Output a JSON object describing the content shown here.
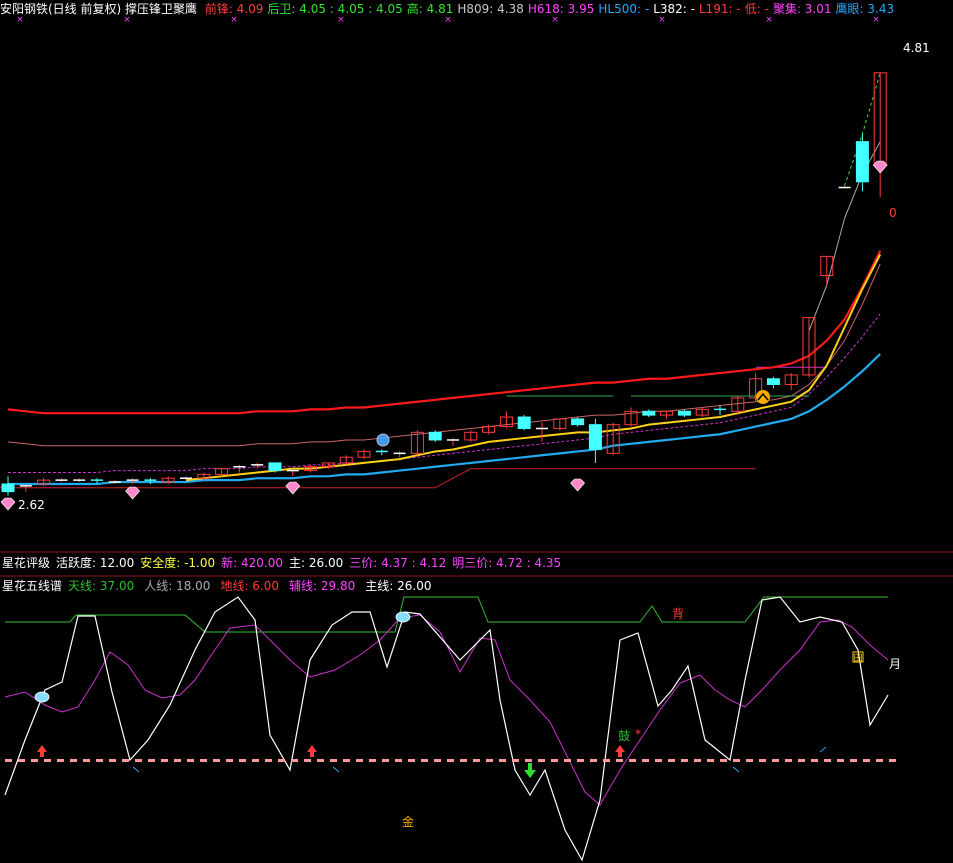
{
  "header": {
    "title": "安阳钢铁(日线 前复权) 撑压锋卫聚鹰",
    "items": [
      {
        "label": "前锋:",
        "value": "4.09",
        "color": "#ff3b3b"
      },
      {
        "label": "后卫:",
        "value": "4.05 : 4.05 : 4.05",
        "color": "#2ee62e"
      },
      {
        "label": "高:",
        "value": "4.81",
        "color": "#2ee62e"
      },
      {
        "label": "H809:",
        "value": "4.38",
        "color": "#c8c8c8"
      },
      {
        "label": "H618:",
        "value": "3.95",
        "color": "#ff44ff"
      },
      {
        "label": "HL500:",
        "value": "-",
        "color": "#22aaff"
      },
      {
        "label": "L382:",
        "value": "-",
        "color": "#ffffff"
      },
      {
        "label": "L191:",
        "value": "-",
        "color": "#ff3b3b"
      },
      {
        "label": "低:",
        "value": "-",
        "color": "#ff3b3b"
      },
      {
        "label": "聚集:",
        "value": "3.01",
        "color": "#ff44ff"
      },
      {
        "label": "鹰眼:",
        "value": "3.43",
        "color": "#22aaff"
      }
    ]
  },
  "colors": {
    "up": "#ff3b3b",
    "down": "#44ffff",
    "ma_red": "#ff1a1a",
    "ma_yellow": "#ffd11a",
    "ma_blue": "#22aaee",
    "purple": "#cc33cc",
    "gray": "#aaaaaa",
    "green": "#33bb33",
    "white": "#ffffff"
  },
  "price_labels": {
    "high": "4.81",
    "low": "2.62",
    "zero": "0"
  },
  "panel2": {
    "label": "星花评级",
    "items": [
      {
        "label": "活跃度:",
        "value": "12.00",
        "color": "#ffffff"
      },
      {
        "label": "安全度:",
        "value": "-1.00",
        "color": "#ffff44"
      },
      {
        "label": "新:",
        "value": "420.00",
        "color": "#ff44ff"
      },
      {
        "label": "主:",
        "value": "26.00",
        "color": "#ffffff"
      },
      {
        "label": "三价:",
        "value": "4.37 : 4.12",
        "color": "#ff44ff"
      },
      {
        "label": "明三价:",
        "value": "4.72 : 4.35",
        "color": "#ff44ff"
      }
    ]
  },
  "panel3": {
    "label": "星花五线谱",
    "items": [
      {
        "label": "天线:",
        "value": "37.00",
        "color": "#33bb33"
      },
      {
        "label": "人线:",
        "value": "18.00",
        "color": "#aaaaaa"
      },
      {
        "label": "地线:",
        "value": "6.00",
        "color": "#ff3b3b"
      },
      {
        "label": "辅线:",
        "value": "29.80",
        "color": "#ff44ff"
      },
      {
        "label": "主线:",
        "value": "26.00",
        "color": "#ffffff"
      }
    ],
    "annotations": {
      "bei": "背",
      "jin": "金",
      "yue": "月",
      "tian": "田",
      "gu": "鼓",
      "star": "*"
    }
  },
  "chart_data": {
    "type": "candlestick",
    "ylim": [
      2.55,
      4.95
    ],
    "candles": [
      [
        2.66,
        2.7,
        2.6,
        2.62
      ],
      [
        2.64,
        2.66,
        2.62,
        2.65
      ],
      [
        2.66,
        2.69,
        2.65,
        2.68
      ],
      [
        2.68,
        2.69,
        2.67,
        2.68
      ],
      [
        2.68,
        2.69,
        2.67,
        2.68
      ],
      [
        2.68,
        2.69,
        2.66,
        2.67
      ],
      [
        2.67,
        2.68,
        2.66,
        2.67
      ],
      [
        2.67,
        2.69,
        2.66,
        2.68
      ],
      [
        2.68,
        2.69,
        2.66,
        2.67
      ],
      [
        2.67,
        2.7,
        2.66,
        2.69
      ],
      [
        2.69,
        2.7,
        2.68,
        2.69
      ],
      [
        2.69,
        2.72,
        2.68,
        2.71
      ],
      [
        2.71,
        2.74,
        2.7,
        2.74
      ],
      [
        2.74,
        2.76,
        2.72,
        2.75
      ],
      [
        2.76,
        2.77,
        2.74,
        2.76
      ],
      [
        2.77,
        2.77,
        2.72,
        2.73
      ],
      [
        2.73,
        2.74,
        2.7,
        2.73
      ],
      [
        2.73,
        2.76,
        2.72,
        2.75
      ],
      [
        2.75,
        2.77,
        2.74,
        2.77
      ],
      [
        2.77,
        2.81,
        2.76,
        2.8
      ],
      [
        2.8,
        2.84,
        2.79,
        2.83
      ],
      [
        2.83,
        2.84,
        2.81,
        2.82
      ],
      [
        2.82,
        2.83,
        2.8,
        2.82
      ],
      [
        2.82,
        2.94,
        2.81,
        2.93
      ],
      [
        2.93,
        2.94,
        2.88,
        2.89
      ],
      [
        2.88,
        2.9,
        2.86,
        2.89
      ],
      [
        2.89,
        2.94,
        2.88,
        2.93
      ],
      [
        2.93,
        2.97,
        2.92,
        2.96
      ],
      [
        2.96,
        3.04,
        2.95,
        3.01
      ],
      [
        3.01,
        3.02,
        2.94,
        2.95
      ],
      [
        2.95,
        2.98,
        2.88,
        2.95
      ],
      [
        2.95,
        3.0,
        2.94,
        3.0
      ],
      [
        3.0,
        3.01,
        2.96,
        2.97
      ],
      [
        2.97,
        3.0,
        2.77,
        2.84
      ],
      [
        2.82,
        2.98,
        2.81,
        2.97
      ],
      [
        2.97,
        3.06,
        2.96,
        3.04
      ],
      [
        3.04,
        3.05,
        3.01,
        3.02
      ],
      [
        3.02,
        3.04,
        3.0,
        3.04
      ],
      [
        3.04,
        3.05,
        3.01,
        3.02
      ],
      [
        3.02,
        3.06,
        3.01,
        3.05
      ],
      [
        3.05,
        3.07,
        3.02,
        3.04
      ],
      [
        3.04,
        3.12,
        3.02,
        3.11
      ],
      [
        3.11,
        3.24,
        3.09,
        3.21
      ],
      [
        3.21,
        3.22,
        3.16,
        3.18
      ],
      [
        3.18,
        3.24,
        3.15,
        3.23
      ],
      [
        3.23,
        3.53,
        3.22,
        3.53
      ],
      [
        3.75,
        3.85,
        3.7,
        3.85
      ],
      [
        4.21,
        4.22,
        4.21,
        4.21
      ],
      [
        4.45,
        4.49,
        4.19,
        4.24
      ],
      [
        4.33,
        4.81,
        4.16,
        4.81
      ]
    ],
    "ma_red": [
      3.05,
      3.04,
      3.03,
      3.03,
      3.03,
      3.03,
      3.03,
      3.03,
      3.03,
      3.03,
      3.03,
      3.03,
      3.03,
      3.03,
      3.04,
      3.04,
      3.04,
      3.05,
      3.05,
      3.06,
      3.06,
      3.07,
      3.08,
      3.09,
      3.1,
      3.11,
      3.12,
      3.13,
      3.14,
      3.15,
      3.16,
      3.17,
      3.18,
      3.19,
      3.19,
      3.2,
      3.21,
      3.21,
      3.22,
      3.23,
      3.24,
      3.25,
      3.26,
      3.27,
      3.29,
      3.33,
      3.41,
      3.52,
      3.69,
      3.88
    ],
    "ma_yellow": [
      null,
      null,
      null,
      null,
      null,
      null,
      null,
      null,
      null,
      null,
      2.68,
      2.69,
      2.7,
      2.71,
      2.72,
      2.73,
      2.74,
      2.74,
      2.75,
      2.76,
      2.77,
      2.78,
      2.79,
      2.81,
      2.83,
      2.84,
      2.86,
      2.88,
      2.89,
      2.9,
      2.91,
      2.92,
      2.93,
      2.93,
      2.94,
      2.95,
      2.97,
      2.98,
      2.99,
      3.0,
      3.01,
      3.03,
      3.05,
      3.07,
      3.09,
      3.15,
      3.28,
      3.48,
      3.68,
      3.86
    ],
    "ma_blue": [
      2.66,
      2.66,
      2.66,
      2.66,
      2.66,
      2.66,
      2.67,
      2.67,
      2.67,
      2.67,
      2.67,
      2.68,
      2.68,
      2.68,
      2.69,
      2.69,
      2.69,
      2.7,
      2.7,
      2.71,
      2.71,
      2.72,
      2.73,
      2.74,
      2.75,
      2.76,
      2.77,
      2.78,
      2.79,
      2.8,
      2.81,
      2.82,
      2.83,
      2.84,
      2.86,
      2.87,
      2.88,
      2.89,
      2.9,
      2.91,
      2.92,
      2.94,
      2.96,
      2.98,
      3.0,
      3.04,
      3.1,
      3.17,
      3.25,
      3.34
    ]
  }
}
